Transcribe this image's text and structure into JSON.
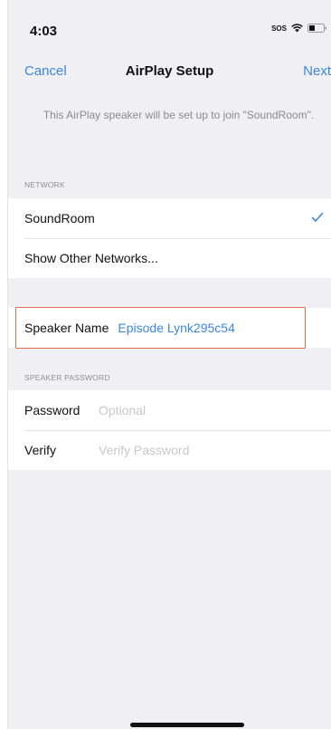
{
  "status": {
    "time": "4:03",
    "sos_label": "SOS",
    "icons": [
      "wifi-icon",
      "battery-icon"
    ]
  },
  "nav": {
    "cancel_label": "Cancel",
    "title": "AirPlay Setup",
    "next_label": "Next"
  },
  "intro_text": "This AirPlay speaker will be set up to join \"SoundRoom\".",
  "network": {
    "header": "NETWORK",
    "items": [
      {
        "label": "SoundRoom",
        "selected": true
      },
      {
        "label": "Show Other Networks..."
      }
    ]
  },
  "speaker": {
    "label": "Speaker Name",
    "value": "Episode Lynk295c54"
  },
  "password_section": {
    "header": "SPEAKER PASSWORD",
    "password_label": "Password",
    "password_placeholder": "Optional",
    "verify_label": "Verify",
    "verify_placeholder": "Verify Password"
  },
  "colors": {
    "accent": "#3a86e0",
    "highlight": "#e36c4c",
    "background": "#efeff4"
  }
}
